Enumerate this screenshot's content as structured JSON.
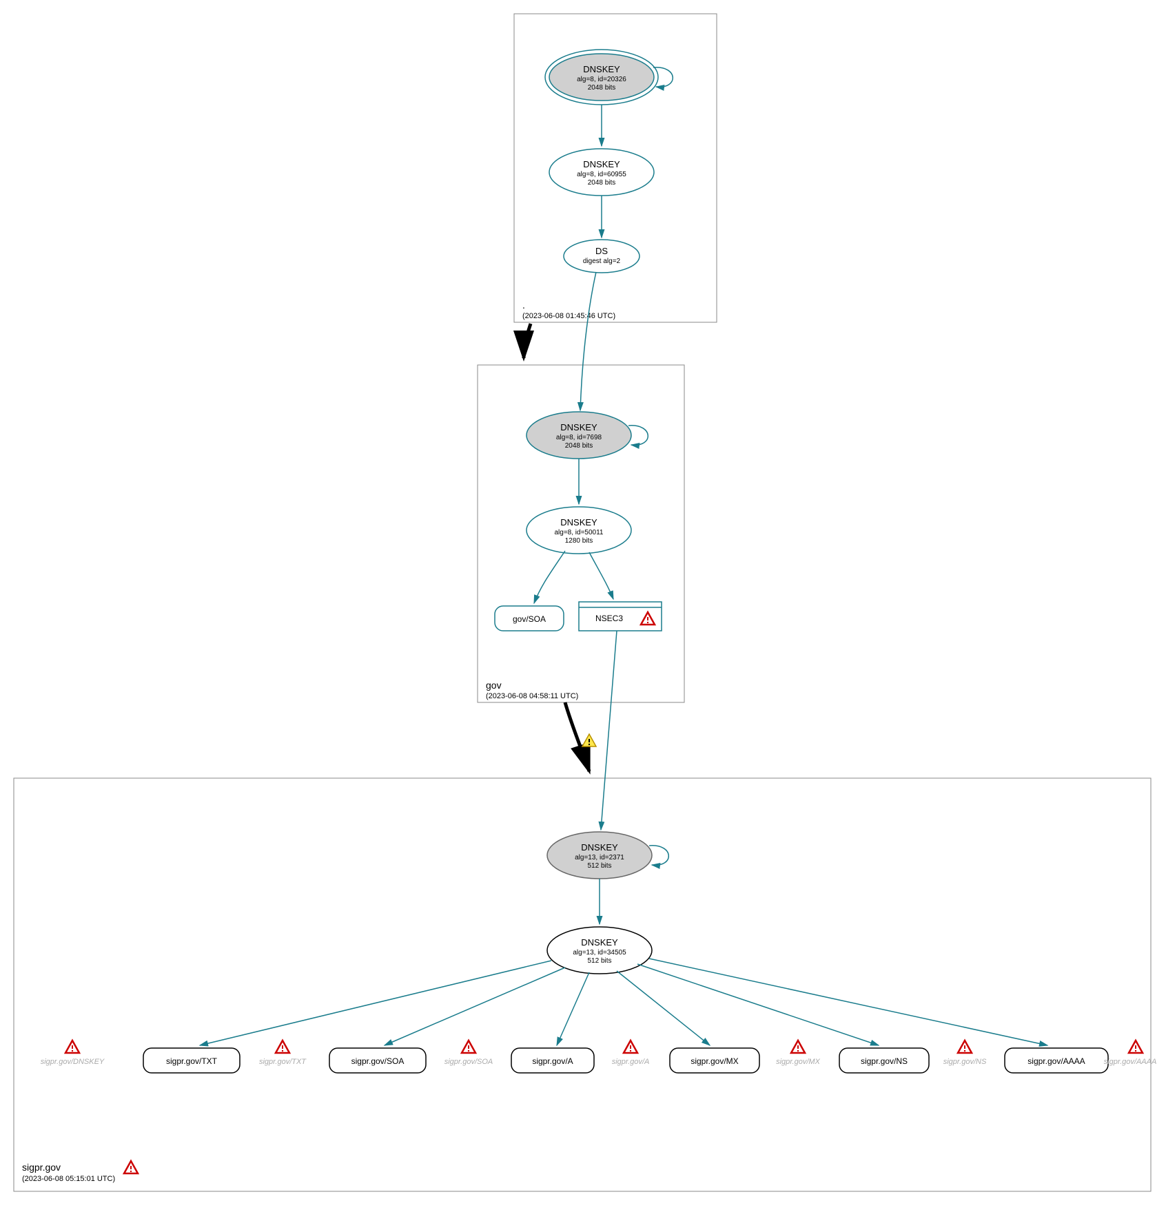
{
  "zones": {
    "root": {
      "label": ".",
      "timestamp": "(2023-06-08 01:45:46 UTC)"
    },
    "gov": {
      "label": "gov",
      "timestamp": "(2023-06-08 04:58:11 UTC)"
    },
    "sigpr": {
      "label": "sigpr.gov",
      "timestamp": "(2023-06-08 05:15:01 UTC)"
    }
  },
  "nodes": {
    "root_ksk": {
      "title": "DNSKEY",
      "line1": "alg=8, id=20326",
      "line2": "2048 bits"
    },
    "root_zsk": {
      "title": "DNSKEY",
      "line1": "alg=8, id=60955",
      "line2": "2048 bits"
    },
    "root_ds": {
      "title": "DS",
      "line1": "digest alg=2"
    },
    "gov_ksk": {
      "title": "DNSKEY",
      "line1": "alg=8, id=7698",
      "line2": "2048 bits"
    },
    "gov_zsk": {
      "title": "DNSKEY",
      "line1": "alg=8, id=50011",
      "line2": "1280 bits"
    },
    "gov_soa": {
      "label": "gov/SOA"
    },
    "gov_nsec3": {
      "label": "NSEC3"
    },
    "sigpr_ksk": {
      "title": "DNSKEY",
      "line1": "alg=13, id=2371",
      "line2": "512 bits"
    },
    "sigpr_zsk": {
      "title": "DNSKEY",
      "line1": "alg=13, id=34505",
      "line2": "512 bits"
    },
    "rr_txt": {
      "label": "sigpr.gov/TXT"
    },
    "rr_soa": {
      "label": "sigpr.gov/SOA"
    },
    "rr_a": {
      "label": "sigpr.gov/A"
    },
    "rr_mx": {
      "label": "sigpr.gov/MX"
    },
    "rr_ns": {
      "label": "sigpr.gov/NS"
    },
    "rr_aaaa": {
      "label": "sigpr.gov/AAAA"
    }
  },
  "nodata": {
    "dnskey": "sigpr.gov/DNSKEY",
    "txt": "sigpr.gov/TXT",
    "soa": "sigpr.gov/SOA",
    "a": "sigpr.gov/A",
    "mx": "sigpr.gov/MX",
    "ns": "sigpr.gov/NS",
    "aaaa": "sigpr.gov/AAAA"
  }
}
